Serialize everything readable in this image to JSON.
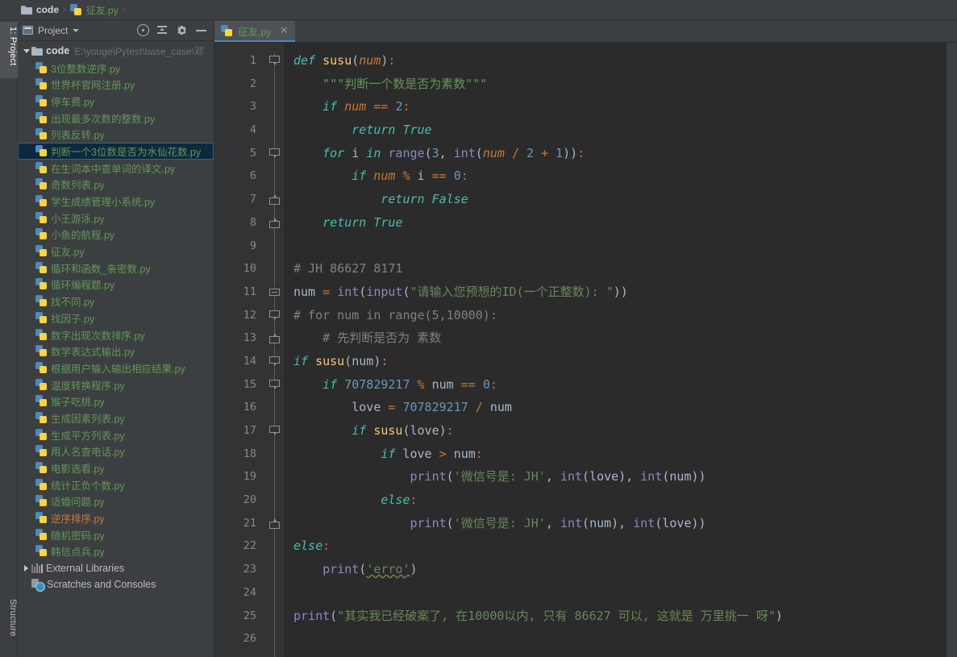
{
  "breadcrumb": {
    "root": "code",
    "separator": "›",
    "file": "征友.py",
    "folder_icon": "folder-icon",
    "file_icon": "python-file-icon"
  },
  "left_strip": {
    "project_tab": "1: Project",
    "structure_tab": "Structure"
  },
  "project_panel": {
    "title": "Project",
    "dropdown_icon": "chevron-down-icon",
    "tools": [
      {
        "name": "locate-target-icon",
        "tooltip": "Select Opened File"
      },
      {
        "name": "collapse-all-icon",
        "tooltip": "Collapse All"
      },
      {
        "name": "gear-icon",
        "tooltip": "Settings"
      },
      {
        "name": "minimize-icon",
        "tooltip": "Hide"
      }
    ],
    "root": {
      "label": "code",
      "path": "E:\\youge\\Pytest\\base_case\\邓",
      "expanded": true
    },
    "files": [
      {
        "label": "3位整数逆序.py",
        "state": "normal"
      },
      {
        "label": "世界杯官网注册.py",
        "state": "normal"
      },
      {
        "label": "停车费.py",
        "state": "normal"
      },
      {
        "label": "出现最多次数的整数.py",
        "state": "normal"
      },
      {
        "label": "列表反转.py",
        "state": "normal"
      },
      {
        "label": "判断一个3位数是否为水仙花数.py",
        "state": "selected"
      },
      {
        "label": "在生词本中查单词的译文.py",
        "state": "normal"
      },
      {
        "label": "奇数列表.py",
        "state": "normal"
      },
      {
        "label": "学生成绩管理小系统.py",
        "state": "normal"
      },
      {
        "label": "小王游泳.py",
        "state": "normal"
      },
      {
        "label": "小鱼的航程.py",
        "state": "normal"
      },
      {
        "label": "征友.py",
        "state": "normal"
      },
      {
        "label": "循环和函数_亲密数.py",
        "state": "normal"
      },
      {
        "label": "循环编程题.py",
        "state": "normal"
      },
      {
        "label": "找不同.py",
        "state": "normal"
      },
      {
        "label": "找因子.py",
        "state": "normal"
      },
      {
        "label": "数字出现次数排序.py",
        "state": "normal"
      },
      {
        "label": "数学表达式输出.py",
        "state": "normal"
      },
      {
        "label": "根据用户输入输出相应结果.py",
        "state": "normal"
      },
      {
        "label": "温度转换程序.py",
        "state": "normal"
      },
      {
        "label": "猴子吃桃.py",
        "state": "normal"
      },
      {
        "label": "生成因素列表.py",
        "state": "normal"
      },
      {
        "label": "生成平方列表.py",
        "state": "normal"
      },
      {
        "label": "用人名查电话.py",
        "state": "normal"
      },
      {
        "label": "电影选看.py",
        "state": "normal"
      },
      {
        "label": "统计正负个数.py",
        "state": "normal"
      },
      {
        "label": "适婚问题.py",
        "state": "normal"
      },
      {
        "label": "逆序排序.py",
        "state": "modified"
      },
      {
        "label": "随机密码.py",
        "state": "normal"
      },
      {
        "label": "韩信点兵.py",
        "state": "normal"
      }
    ],
    "extras": [
      {
        "label": "External Libraries",
        "icon": "libraries-icon",
        "expandable": true
      },
      {
        "label": "Scratches and Consoles",
        "icon": "scratches-icon",
        "expandable": false
      }
    ]
  },
  "editor": {
    "tab": {
      "label": "征友.py",
      "icon": "python-file-icon",
      "close_icon": "close-icon",
      "active": true
    },
    "line_numbers": [
      "1",
      "2",
      "3",
      "4",
      "5",
      "6",
      "7",
      "8",
      "9",
      "10",
      "11",
      "12",
      "13",
      "14",
      "15",
      "16",
      "17",
      "18",
      "19",
      "20",
      "21",
      "22",
      "23",
      "24",
      "25",
      "26"
    ],
    "code_lines": [
      "def susu(num):",
      "    \"\"\"判断一个数是否为素数\"\"\"",
      "    if num == 2:",
      "        return True",
      "    for i in range(3, int(num / 2 + 1)):",
      "        if num % i == 0:",
      "            return False",
      "    return True",
      "",
      "# JH 86627 8171",
      "num = int(input(\"请输入您预想的ID(一个正整数): \"))",
      "# for num in range(5,10000):",
      "    # 先判断是否为 素数",
      "if susu(num):",
      "    if 707829217 % num == 0:",
      "        love = 707829217 / num",
      "        if susu(love):",
      "            if love > num:",
      "                print('微信号是: JH', int(love), int(num))",
      "            else:",
      "                print('微信号是: JH', int(num), int(love))",
      "else:",
      "    print('erro')",
      "",
      "print(\"其实我已经破案了, 在10000以内, 只有 86627 可以, 这就是 万里挑一 呀\")",
      ""
    ]
  }
}
